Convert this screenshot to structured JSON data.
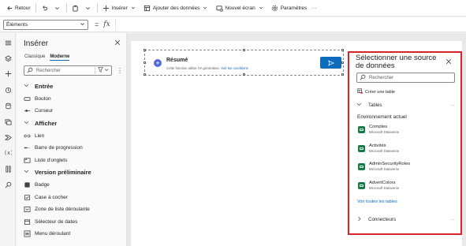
{
  "commandbar": {
    "back_label": "Retour",
    "insert_label": "Insérer",
    "add_data_label": "Ajouter des données",
    "new_screen_label": "Nouvel écran",
    "settings_label": "Paramètres",
    "more_label": "···"
  },
  "formulabar": {
    "property_value": "Éléments",
    "equals": "=",
    "fx": "fx"
  },
  "insert_panel": {
    "title": "Insérer",
    "tabs": [
      "Classique",
      "Moderne"
    ],
    "active_tab": "Moderne",
    "search_placeholder": "Rechercher",
    "items": [
      {
        "type": "section",
        "label": "Entrée"
      },
      {
        "type": "item",
        "label": "Bouton",
        "icon": "button-icon"
      },
      {
        "type": "item",
        "label": "Curseur",
        "icon": "slider-icon"
      },
      {
        "type": "section",
        "label": "Afficher"
      },
      {
        "type": "item",
        "label": "Lien",
        "icon": "link-icon"
      },
      {
        "type": "item",
        "label": "Barre de progression",
        "icon": "progress-icon"
      },
      {
        "type": "item",
        "label": "Liste d'onglets",
        "icon": "tablist-icon"
      },
      {
        "type": "section",
        "label": "Version préliminaire"
      },
      {
        "type": "item",
        "label": "Badge",
        "icon": "badge-icon"
      },
      {
        "type": "item",
        "label": "Case à cocher",
        "icon": "checkbox-icon"
      },
      {
        "type": "item",
        "label": "Zone de liste déroulante",
        "icon": "combobox-icon"
      },
      {
        "type": "item",
        "label": "Sélecteur de dates",
        "icon": "datepicker-icon"
      },
      {
        "type": "item",
        "label": "Menu déroulant",
        "icon": "dropdown-icon"
      }
    ]
  },
  "component": {
    "title": "Résumé",
    "subtitle": "Cette fonction utilise l'IA générative.",
    "link": "Voir les conditions"
  },
  "data_pane": {
    "title": "Sélectionner une source de données",
    "search_placeholder": "Rechercher",
    "create_table": "Créer une table",
    "tables_label": "Tables",
    "environment_label": "Environnement actuel",
    "sources": [
      {
        "name": "Comptes",
        "source": "Microsoft Dataverse"
      },
      {
        "name": "Activités",
        "source": "Microsoft Dataverse"
      },
      {
        "name": "AdminSecurityRoles",
        "source": "Microsoft Dataverse"
      },
      {
        "name": "AdvertColors",
        "source": "Microsoft Dataverse"
      }
    ],
    "see_all": "Voir toutes les tables",
    "connectors_label": "Connecteurs",
    "more": "···"
  },
  "colors": {
    "accent": "#0f6cbd",
    "highlight_border": "#d8232a",
    "dataverse_green": "#107c41"
  }
}
